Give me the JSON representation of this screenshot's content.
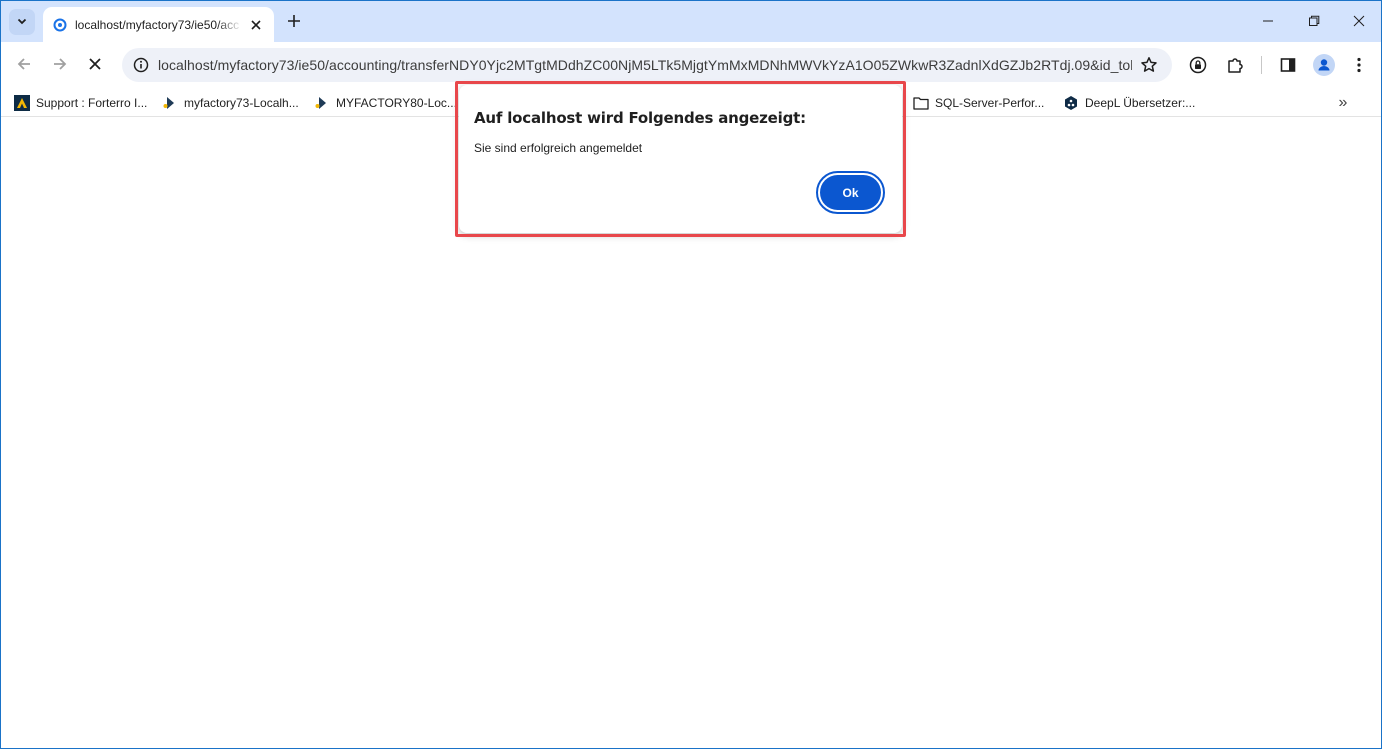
{
  "tab": {
    "title": "localhost/myfactory73/ie50/acc",
    "new_tab_symbol": "+"
  },
  "toolbar": {
    "url": "localhost/myfactory73/ie50/accounting/transferNDY0Yjc2MTgtMDdhZC00NjM5LTk5MjgtYmMxMDNhMWVkYzA1O05ZWkwR3ZadnlXdGZJb2RTdj.09&id_tok..."
  },
  "bookmarks": [
    {
      "label": "Support : Forterro I...",
      "icon": "forterro-icon"
    },
    {
      "label": "myfactory73-Localh...",
      "icon": "myfactory-icon"
    },
    {
      "label": "MYFACTORY80-Loc...",
      "icon": "myfactory-icon"
    },
    {
      "label": "SQL-Server-Perfor...",
      "icon": "folder-icon"
    },
    {
      "label": "DeepL Übersetzer:...",
      "icon": "deepl-icon"
    }
  ],
  "bookmarks_more": "»",
  "dialog": {
    "title": "Auf localhost wird Folgendes angezeigt:",
    "message": "Sie sind erfolgreich angemeldet",
    "ok_label": "Ok"
  },
  "colors": {
    "tabstrip": "#d3e3fd",
    "omnibox": "#eef1f8",
    "ok_button": "#0b57d0",
    "highlight": "#e8474b"
  }
}
